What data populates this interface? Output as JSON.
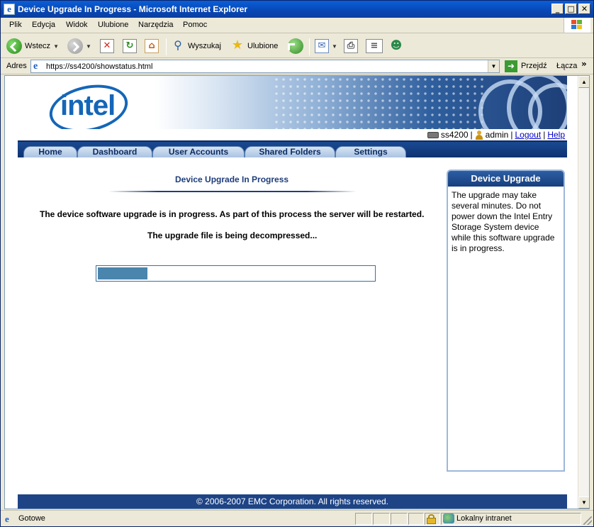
{
  "window": {
    "title": "Device Upgrade In Progress - Microsoft Internet Explorer",
    "controls": {
      "minimize": "_",
      "maximize": "□",
      "close": "✕"
    }
  },
  "menu": {
    "items": [
      {
        "label": "Plik"
      },
      {
        "label": "Edycja"
      },
      {
        "label": "Widok"
      },
      {
        "label": "Ulubione"
      },
      {
        "label": "Narzędzia"
      },
      {
        "label": "Pomoc"
      }
    ]
  },
  "toolbar": {
    "back_label": "Wstecz",
    "search_label": "Wyszukaj",
    "favorites_label": "Ulubione"
  },
  "address": {
    "label": "Adres",
    "url": "https://ss4200/showstatus.html",
    "go_label": "Przejdź",
    "links_label": "Łącza"
  },
  "page": {
    "logo_text": "intel",
    "user_bar": {
      "server": "ss4200",
      "separator": "|",
      "user": "admin",
      "logout": "Logout",
      "help": "Help"
    },
    "nav_tabs": [
      {
        "label": "Home"
      },
      {
        "label": "Dashboard"
      },
      {
        "label": "User Accounts"
      },
      {
        "label": "Shared Folders"
      },
      {
        "label": "Settings"
      }
    ],
    "main": {
      "title": "Device Upgrade In Progress",
      "message": "The device software upgrade is in progress. As part of this process the server will be restarted.",
      "status": "The upgrade file is being decompressed...",
      "progress_fraction": 0.18
    },
    "side_panel": {
      "title": "Device Upgrade",
      "body": "The upgrade may take several minutes. Do not power down the Intel Entry Storage System device while this software upgrade is in progress."
    },
    "footer": "© 2006-2007 EMC Corporation. All rights reserved."
  },
  "status_bar": {
    "text": "Gotowe",
    "zone": "Lokalny intranet"
  },
  "colors": {
    "nav_bg": "#0e3270",
    "footer_bg": "#1e4486",
    "progress_fill": "#4a85ad",
    "link": "#0000cc"
  }
}
